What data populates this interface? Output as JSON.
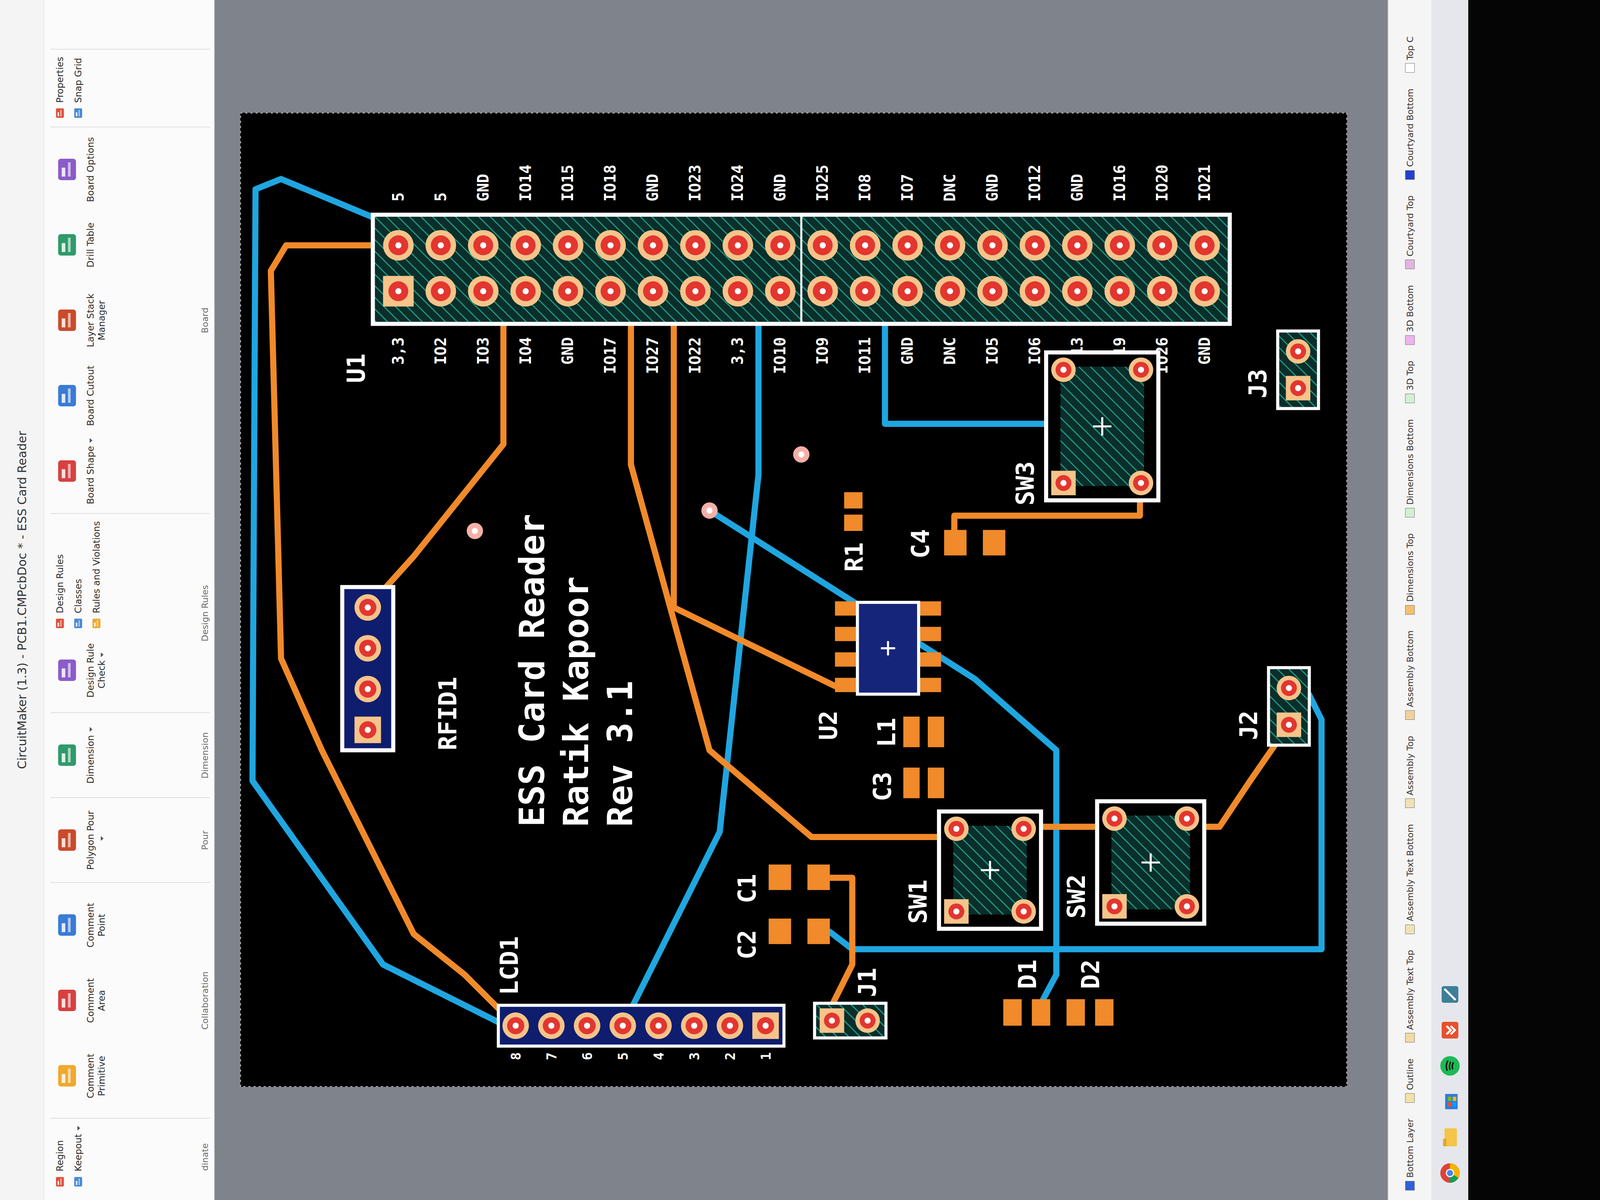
{
  "window": {
    "title": "CircuitMaker (1.3) - PCB1.CMPcbDoc * - ESS Card Reader"
  },
  "ribbon": {
    "groups": [
      {
        "label": "dinate",
        "items": [
          {
            "label": "Region",
            "kind": "small",
            "dropdown": false
          },
          {
            "label": "Keepout",
            "kind": "small",
            "dropdown": true
          }
        ]
      },
      {
        "label": "Collaboration",
        "items": [
          {
            "label": "Comment Primitive",
            "kind": "large",
            "dropdown": false
          },
          {
            "label": "Comment Area",
            "kind": "large",
            "dropdown": false
          },
          {
            "label": "Comment Point",
            "kind": "large",
            "dropdown": false
          }
        ]
      },
      {
        "label": "Pour",
        "items": [
          {
            "label": "Polygon Pour",
            "kind": "large",
            "dropdown": true
          }
        ]
      },
      {
        "label": "Dimension",
        "items": [
          {
            "label": "Dimension",
            "kind": "large",
            "dropdown": true
          }
        ]
      },
      {
        "label": "Design Rules",
        "items": [
          {
            "label": "Design Rule Check",
            "kind": "large",
            "dropdown": true
          },
          {
            "label": "Design Rules",
            "kind": "small",
            "dropdown": false
          },
          {
            "label": "Classes",
            "kind": "small",
            "dropdown": false
          },
          {
            "label": "Rules and Violations",
            "kind": "small",
            "dropdown": false
          }
        ]
      },
      {
        "label": "Board",
        "items": [
          {
            "label": "Board Shape",
            "kind": "large",
            "dropdown": true
          },
          {
            "label": "Board Cutout",
            "kind": "large",
            "dropdown": false
          },
          {
            "label": "Layer Stack Manager",
            "kind": "large",
            "dropdown": false
          },
          {
            "label": "Drill Table",
            "kind": "large",
            "dropdown": false
          },
          {
            "label": "Board Options",
            "kind": "large",
            "dropdown": false
          }
        ]
      },
      {
        "label": "",
        "items": [
          {
            "label": "Properties",
            "kind": "small",
            "dropdown": false
          },
          {
            "label": "Snap Grid",
            "kind": "small",
            "dropdown": false
          }
        ]
      }
    ]
  },
  "board": {
    "notes": [
      "ESS Card Reader",
      "Ratik Kapoor",
      "Rev 3.1"
    ],
    "header": {
      "designator": "U1",
      "row_a": [
        "5",
        "5",
        "GND",
        "IO14",
        "IO15",
        "IO18",
        "GND",
        "IO23",
        "IO24",
        "GND",
        "IO25",
        "IO8",
        "IO7",
        "DNC",
        "GND",
        "IO12",
        "GND",
        "IO16",
        "IO20",
        "IO21"
      ],
      "row_b": [
        "3,3",
        "IO2",
        "IO3",
        "IO4",
        "GND",
        "IO17",
        "IO27",
        "IO22",
        "3,3",
        "IO10",
        "IO9",
        "IO11",
        "GND",
        "DNC",
        "IO5",
        "IO6",
        "IO13",
        "IO19",
        "IO26",
        "GND"
      ]
    },
    "lcd": {
      "designator": "LCD1",
      "pin_numbers": [
        "8",
        "7",
        "6",
        "5",
        "4",
        "3",
        "2",
        "1"
      ]
    },
    "parts": [
      {
        "designator": "RFID1",
        "kind": "header4"
      },
      {
        "designator": "U2",
        "kind": "soic8"
      },
      {
        "designator": "R1",
        "kind": "smd2"
      },
      {
        "designator": "C4",
        "kind": "smd2"
      },
      {
        "designator": "L1",
        "kind": "smd2"
      },
      {
        "designator": "C3",
        "kind": "smd2"
      },
      {
        "designator": "C1",
        "kind": "smd2"
      },
      {
        "designator": "C2",
        "kind": "smd2"
      },
      {
        "designator": "J1",
        "kind": "header2"
      },
      {
        "designator": "D1",
        "kind": "diode"
      },
      {
        "designator": "D2",
        "kind": "diode"
      },
      {
        "designator": "SW1",
        "kind": "switch"
      },
      {
        "designator": "SW2",
        "kind": "switch"
      },
      {
        "designator": "SW3",
        "kind": "switch"
      },
      {
        "designator": "J2",
        "kind": "header2"
      },
      {
        "designator": "J3",
        "kind": "header2"
      }
    ]
  },
  "layer_tabs": [
    {
      "label": "Bottom Layer",
      "color": "#2f62d8"
    },
    {
      "label": "Outline",
      "color": "#f1e3a8"
    },
    {
      "label": "Assembly Text Top",
      "color": "#f3d9a4"
    },
    {
      "label": "Assembly Text Bottom",
      "color": "#efe2b6"
    },
    {
      "label": "Assembly Top",
      "color": "#efe2b6"
    },
    {
      "label": "Assembly Bottom",
      "color": "#f1d29e"
    },
    {
      "label": "Dimensions Top",
      "color": "#f5c06e"
    },
    {
      "label": "Dimensions Bottom",
      "color": "#d3f0d3"
    },
    {
      "label": "3D Top",
      "color": "#d3f0d3"
    },
    {
      "label": "3D Bottom",
      "color": "#efb3ef"
    },
    {
      "label": "Courtyard Top",
      "color": "#e2b4e2"
    },
    {
      "label": "Courtyard Bottom",
      "color": "#2340d0"
    },
    {
      "label": "Top C",
      "color": "#ffffff"
    }
  ]
}
